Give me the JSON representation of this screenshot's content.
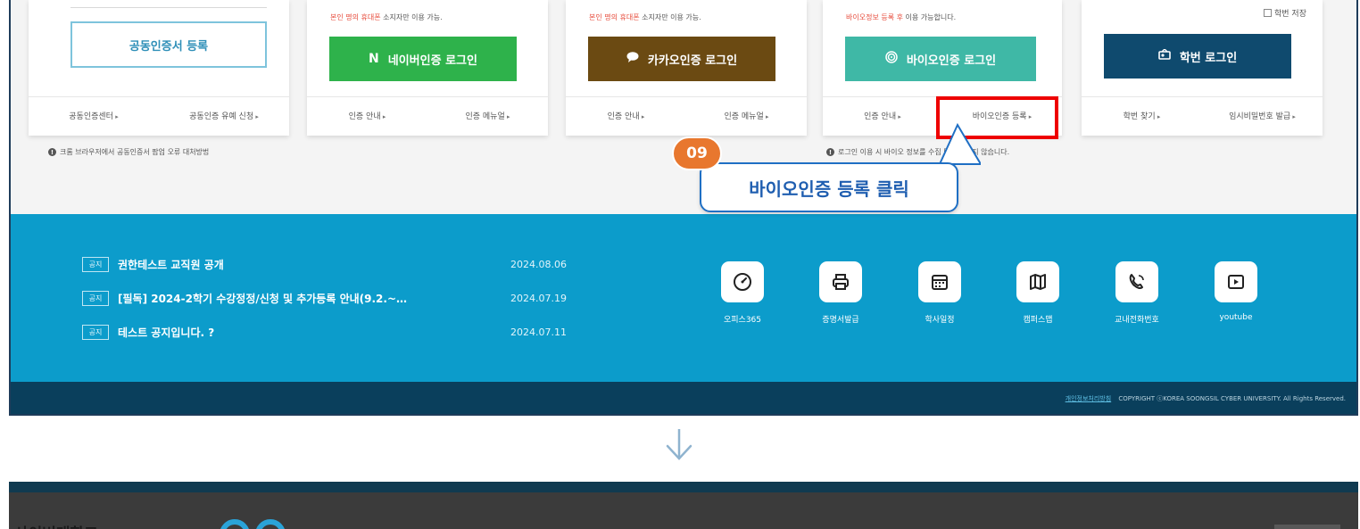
{
  "login": {
    "cert": {
      "register_label": "공동인증서 등록",
      "links": [
        "공동인증센터",
        "공동인증 유예 신청"
      ]
    },
    "naver": {
      "note_red": "본인 명의 휴대폰",
      "note_rest": " 소지자만 이용 가능.",
      "button_label": "네이버인증 로그인",
      "button_icon": "N",
      "links": [
        "인증 안내",
        "인증 메뉴얼"
      ]
    },
    "kakao": {
      "note_red": "본인 명의 휴대폰",
      "note_rest": " 소지자만 이용 가능.",
      "button_label": "카카오인증 로그인",
      "links": [
        "인증 안내",
        "인증 메뉴얼"
      ]
    },
    "bio": {
      "note_red": "바이오정보 등록 후",
      "note_rest": " 이용 가능합니다.",
      "button_label": "바이오인증 로그인",
      "links": [
        "인증 안내",
        "바이오인증 등록"
      ],
      "bottom_note": "로그인 이용 시 바이오 정보를 수집 및 저장하지 않습니다."
    },
    "student": {
      "save_id_label": "학번 저장",
      "button_label": "학번 로그인",
      "links": [
        "학번 찾기",
        "임시비밀번호 발급"
      ]
    },
    "chrome_note": "크롬 브라우저에서 공동인증서 팝업 오류 대처방법"
  },
  "annotation": {
    "step": "09",
    "text": "바이오인증 등록 클릭"
  },
  "notices": [
    {
      "tag": "공지",
      "title": "권한테스트 교직원 공개",
      "date": "2024.08.06"
    },
    {
      "tag": "공지",
      "title": "[필독] 2024-2학기 수강정정/신청 및 추가등록 안내(9.2.~…",
      "date": "2024.07.19"
    },
    {
      "tag": "공지",
      "title": "테스트 공지입니다. ?",
      "date": "2024.07.11"
    }
  ],
  "quick_links": [
    {
      "label": "오피스365",
      "icon": "gauge-icon"
    },
    {
      "label": "증명서발급",
      "icon": "printer-icon"
    },
    {
      "label": "학사일정",
      "icon": "calendar-icon"
    },
    {
      "label": "캠퍼스맵",
      "icon": "map-icon"
    },
    {
      "label": "교내전화번호",
      "icon": "phone-icon"
    },
    {
      "label": "youtube",
      "icon": "play-icon"
    }
  ],
  "footer": {
    "privacy": "개인정보처리방침",
    "copyright": "COPYRIGHT ⓒKOREA SOONGSIL CYBER UNIVERSITY. All Rights Reserved."
  },
  "next_screen": {
    "partial_title": "사이버대학교"
  },
  "colors": {
    "naver": "#2eb24b",
    "kakao": "#6b4a12",
    "bio": "#3fb8a6",
    "student": "#0f4a6e",
    "footer": "#0c9ccb",
    "highlight": "#ee0000",
    "badge": "#e8772e"
  }
}
